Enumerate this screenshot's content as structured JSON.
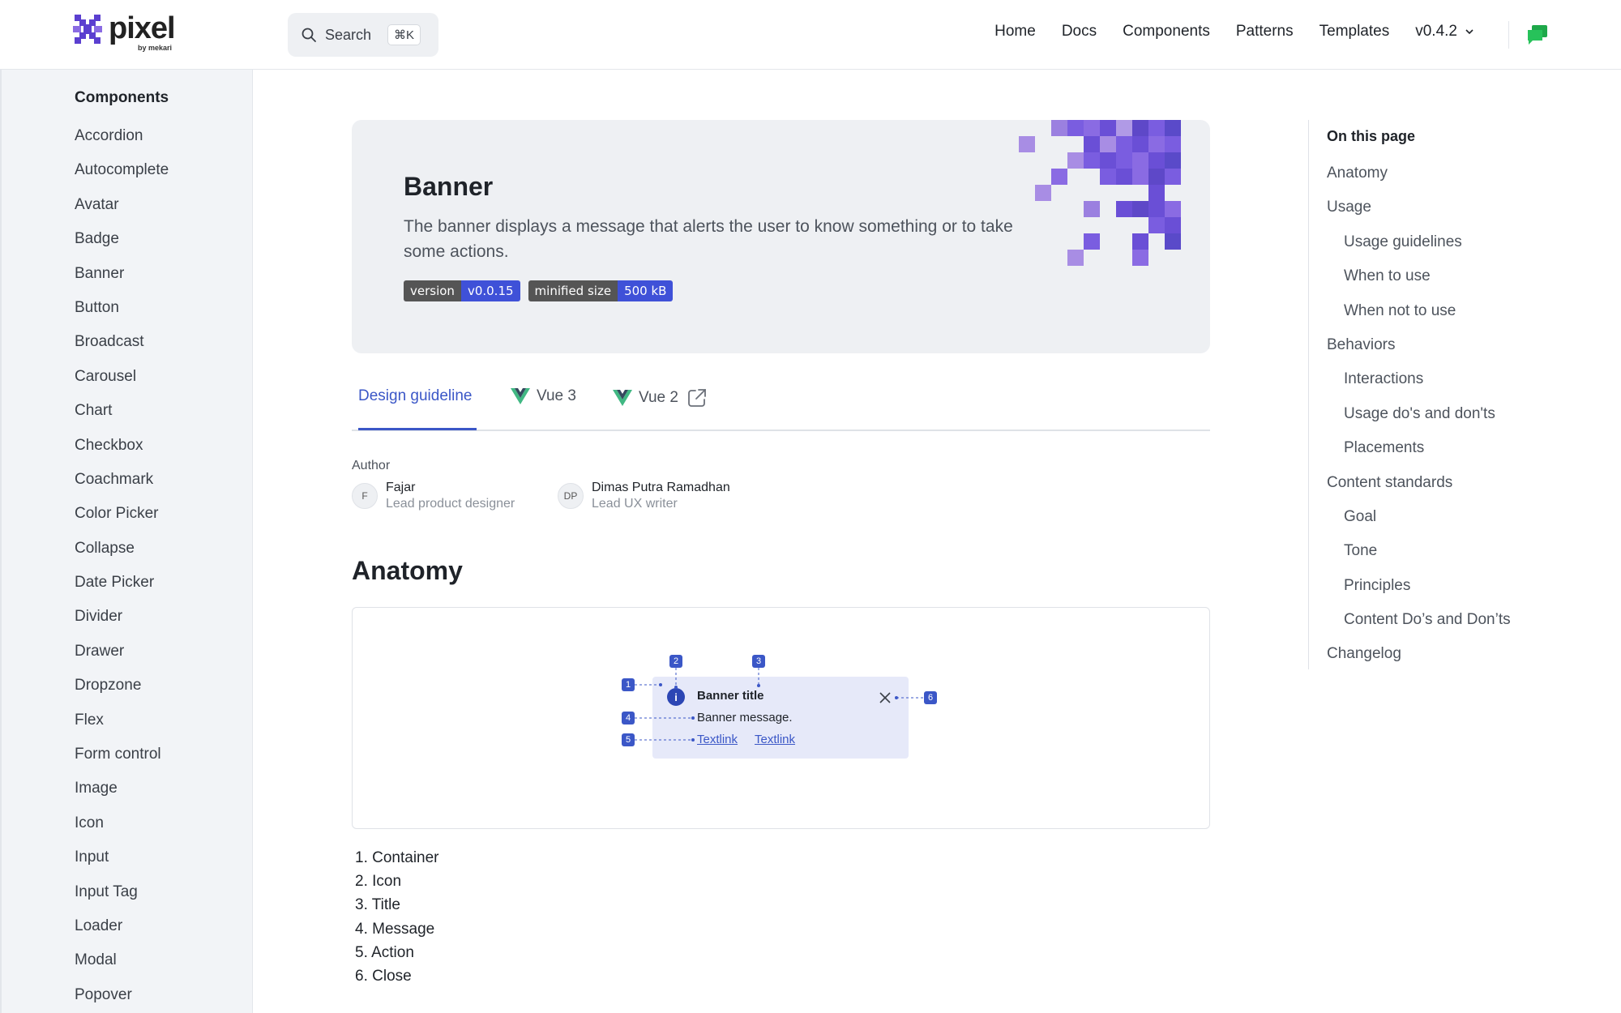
{
  "header": {
    "logo": {
      "word": "pixel",
      "by": "by mekari"
    },
    "search": {
      "label": "Search",
      "shortcut": "⌘K"
    },
    "nav": [
      "Home",
      "Docs",
      "Components",
      "Patterns",
      "Templates"
    ],
    "version": "v0.4.2",
    "colors": {
      "brand": "#5b3fd0",
      "chat": "#1ea84a"
    }
  },
  "sidebar": {
    "title": "Components",
    "items": [
      "Accordion",
      "Autocomplete",
      "Avatar",
      "Badge",
      "Banner",
      "Button",
      "Broadcast",
      "Carousel",
      "Chart",
      "Checkbox",
      "Coachmark",
      "Color Picker",
      "Collapse",
      "Date Picker",
      "Divider",
      "Drawer",
      "Dropzone",
      "Flex",
      "Form control",
      "Image",
      "Icon",
      "Input",
      "Input Tag",
      "Loader",
      "Modal",
      "Popover"
    ]
  },
  "hero": {
    "title": "Banner",
    "description": "The banner displays a message that alerts the user to know something or to take some actions.",
    "badges": [
      {
        "key": "version",
        "value": "v0.0.15"
      },
      {
        "key": "minified size",
        "value": "500 kB"
      }
    ]
  },
  "tabs": [
    {
      "label": "Design guideline",
      "active": true
    },
    {
      "label": "Vue 3",
      "icon": "vue-icon"
    },
    {
      "label": "Vue 2",
      "icon": "vue-icon",
      "external": true
    }
  ],
  "author": {
    "label": "Author",
    "people": [
      {
        "initials": "F",
        "name": "Fajar",
        "role": "Lead product designer"
      },
      {
        "initials": "DP",
        "name": "Dimas Putra Ramadhan",
        "role": "Lead UX writer"
      }
    ]
  },
  "anatomy": {
    "title": "Anatomy",
    "demo": {
      "title": "Banner title",
      "message": "Banner message.",
      "links": [
        "Textlink",
        "Textlink"
      ],
      "callouts": [
        "1",
        "2",
        "3",
        "4",
        "5",
        "6"
      ]
    },
    "parts": [
      "1. Container",
      "2. Icon",
      "3. Title",
      "4. Message",
      "5. Action",
      "6. Close"
    ]
  },
  "toc": {
    "title": "On this page",
    "items": [
      {
        "label": "Anatomy",
        "level": 1
      },
      {
        "label": "Usage",
        "level": 1
      },
      {
        "label": "Usage guidelines",
        "level": 2
      },
      {
        "label": "When to use",
        "level": 2
      },
      {
        "label": "When not to use",
        "level": 2
      },
      {
        "label": "Behaviors",
        "level": 1
      },
      {
        "label": "Interactions",
        "level": 2
      },
      {
        "label": "Usage do's and don'ts",
        "level": 2
      },
      {
        "label": "Placements",
        "level": 2
      },
      {
        "label": "Content standards",
        "level": 1
      },
      {
        "label": "Goal",
        "level": 2
      },
      {
        "label": "Tone",
        "level": 2
      },
      {
        "label": "Principles",
        "level": 2
      },
      {
        "label": "Content Do’s and Don’ts",
        "level": 2
      },
      {
        "label": "Changelog",
        "level": 1
      }
    ]
  }
}
